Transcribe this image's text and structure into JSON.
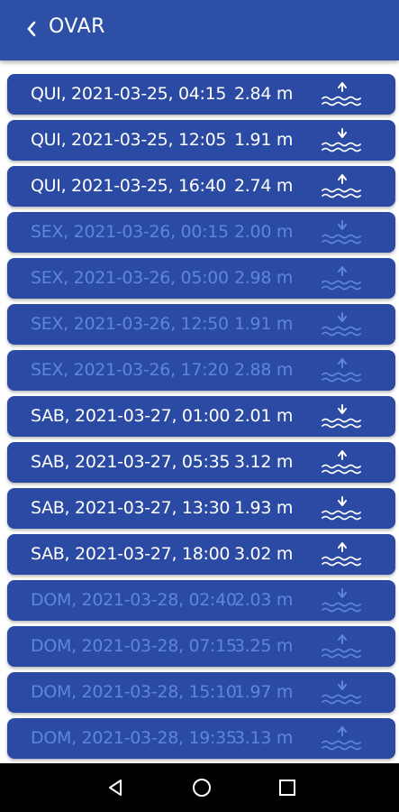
{
  "header": {
    "title": "OVAR"
  },
  "tides": [
    {
      "datetime": "QUI, 2021-03-25, 04:15",
      "height": "2.84 m",
      "type": "high",
      "dim": false
    },
    {
      "datetime": "QUI, 2021-03-25, 12:05",
      "height": "1.91 m",
      "type": "low",
      "dim": false
    },
    {
      "datetime": "QUI, 2021-03-25, 16:40",
      "height": "2.74 m",
      "type": "high",
      "dim": false
    },
    {
      "datetime": "SEX, 2021-03-26, 00:15",
      "height": "2.00 m",
      "type": "low",
      "dim": true
    },
    {
      "datetime": "SEX, 2021-03-26, 05:00",
      "height": "2.98 m",
      "type": "high",
      "dim": true
    },
    {
      "datetime": "SEX, 2021-03-26, 12:50",
      "height": "1.91 m",
      "type": "low",
      "dim": true
    },
    {
      "datetime": "SEX, 2021-03-26, 17:20",
      "height": "2.88 m",
      "type": "high",
      "dim": true
    },
    {
      "datetime": "SAB, 2021-03-27, 01:00",
      "height": "2.01 m",
      "type": "low",
      "dim": false
    },
    {
      "datetime": "SAB, 2021-03-27, 05:35",
      "height": "3.12 m",
      "type": "high",
      "dim": false
    },
    {
      "datetime": "SAB, 2021-03-27, 13:30",
      "height": "1.93 m",
      "type": "low",
      "dim": false
    },
    {
      "datetime": "SAB, 2021-03-27, 18:00",
      "height": "3.02 m",
      "type": "high",
      "dim": false
    },
    {
      "datetime": "DOM, 2021-03-28, 02:40",
      "height": "2.03 m",
      "type": "low",
      "dim": true
    },
    {
      "datetime": "DOM, 2021-03-28, 07:15",
      "height": "3.25 m",
      "type": "high",
      "dim": true
    },
    {
      "datetime": "DOM, 2021-03-28, 15:10",
      "height": "1.97 m",
      "type": "low",
      "dim": true
    },
    {
      "datetime": "DOM, 2021-03-28, 19:35",
      "height": "3.13 m",
      "type": "high",
      "dim": true
    }
  ],
  "icons": {
    "back": "chevron-left-icon",
    "high": "high-tide-icon",
    "low": "low-tide-icon",
    "nav_back": "triangle-back-icon",
    "nav_home": "circle-home-icon",
    "nav_recents": "square-recents-icon"
  },
  "colors": {
    "appbar": "#2d4fa6",
    "row": "#2b4aa3",
    "text": "#ffffff",
    "dim_text": "#5e86d8"
  }
}
